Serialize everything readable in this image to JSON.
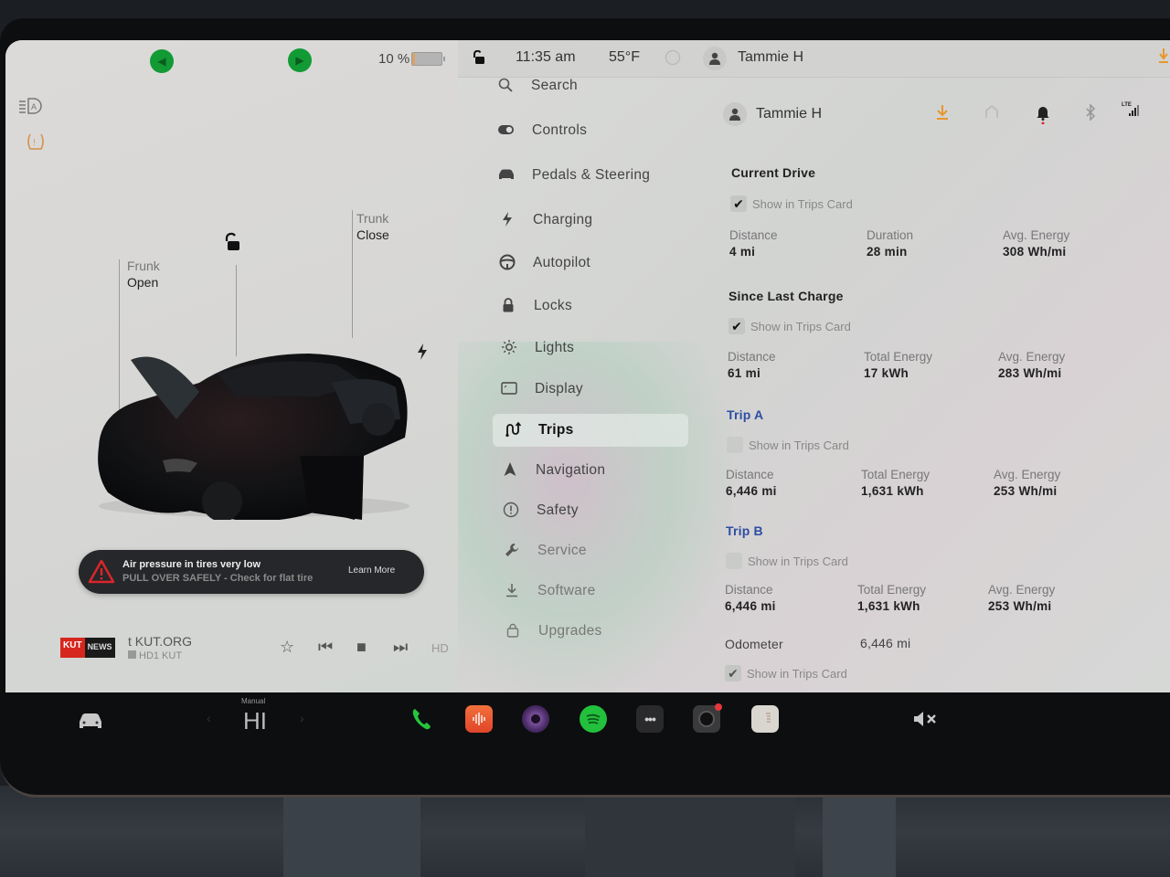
{
  "status_bar": {
    "battery_percent_label": "10 %",
    "battery_level": 0.1,
    "time": "11:35 am",
    "temperature": "55°F",
    "user_name": "Tammie H"
  },
  "car_view": {
    "frunk_label": "Frunk",
    "frunk_state": "Open",
    "trunk_label": "Trunk",
    "trunk_state": "Close",
    "lock_state": "unlocked"
  },
  "alert": {
    "title": "Air pressure in tires very low",
    "subtitle": "PULL OVER SAFELY - Check for flat tire",
    "action": "Learn More"
  },
  "media": {
    "logo_left": "KUT",
    "logo_right": "NEWS",
    "station": "t KUT.ORG",
    "sub": "HD1 KUT"
  },
  "menu": {
    "items": [
      {
        "label": "Search",
        "icon": "search-icon"
      },
      {
        "label": "Controls",
        "icon": "toggle-icon"
      },
      {
        "label": "Pedals & Steering",
        "icon": "car-icon"
      },
      {
        "label": "Charging",
        "icon": "bolt-icon"
      },
      {
        "label": "Autopilot",
        "icon": "steering-wheel-icon"
      },
      {
        "label": "Locks",
        "icon": "lock-icon"
      },
      {
        "label": "Lights",
        "icon": "sun-icon"
      },
      {
        "label": "Display",
        "icon": "display-icon"
      },
      {
        "label": "Trips",
        "icon": "trips-icon",
        "active": true
      },
      {
        "label": "Navigation",
        "icon": "navigation-icon"
      },
      {
        "label": "Safety",
        "icon": "safety-icon"
      },
      {
        "label": "Service",
        "icon": "wrench-icon"
      },
      {
        "label": "Software",
        "icon": "download-icon"
      },
      {
        "label": "Upgrades",
        "icon": "bag-icon"
      }
    ]
  },
  "details": {
    "user_name": "Tammie H",
    "show_in_trips_card": "Show in Trips Card",
    "current_drive": {
      "title": "Current Drive",
      "checked": true,
      "stats": [
        {
          "label": "Distance",
          "value": "4 mi"
        },
        {
          "label": "Duration",
          "value": "28 min"
        },
        {
          "label": "Avg. Energy",
          "value": "308 Wh/mi"
        }
      ]
    },
    "since_last_charge": {
      "title": "Since Last Charge",
      "checked": true,
      "stats": [
        {
          "label": "Distance",
          "value": "61 mi"
        },
        {
          "label": "Total Energy",
          "value": "17 kWh"
        },
        {
          "label": "Avg. Energy",
          "value": "283 Wh/mi"
        }
      ]
    },
    "trip_a": {
      "title": "Trip A",
      "checked": false,
      "stats": [
        {
          "label": "Distance",
          "value": "6,446 mi"
        },
        {
          "label": "Total Energy",
          "value": "1,631 kWh"
        },
        {
          "label": "Avg. Energy",
          "value": "253 Wh/mi"
        }
      ]
    },
    "trip_b": {
      "title": "Trip B",
      "checked": false,
      "stats": [
        {
          "label": "Distance",
          "value": "6,446 mi"
        },
        {
          "label": "Total Energy",
          "value": "1,631 kWh"
        },
        {
          "label": "Avg. Energy",
          "value": "253 Wh/mi"
        }
      ]
    },
    "odometer": {
      "label": "Odometer",
      "value": "6,446 mi",
      "checked": true
    }
  },
  "taskbar": {
    "climate_mode": "Manual",
    "climate_value": "HI"
  },
  "colors": {
    "accent_blue": "#2d4ea3",
    "turn_signal_green": "#129a34",
    "alert_red": "#d9262a",
    "download_orange": "#e8962e"
  }
}
